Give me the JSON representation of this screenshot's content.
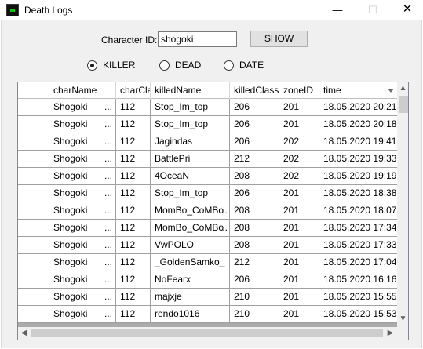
{
  "window": {
    "title": "Death Logs",
    "minimize_glyph": "—",
    "maximize_glyph": "☐",
    "close_glyph": "✕"
  },
  "form": {
    "character_label": "Character ID:",
    "character_value": "shogoki",
    "show_label": "SHOW",
    "radios": [
      {
        "label": "KILLER",
        "checked": true
      },
      {
        "label": "DEAD",
        "checked": false
      },
      {
        "label": "DATE",
        "checked": false
      }
    ]
  },
  "grid": {
    "columns": [
      "charName",
      "charCla",
      "killedName",
      "killedClass",
      "zoneID",
      "time"
    ],
    "rows": [
      [
        "Shogoki",
        "112",
        "Stop_Im_top",
        "206",
        "201",
        "18.05.2020 20:21"
      ],
      [
        "Shogoki",
        "112",
        "Stop_Im_top",
        "206",
        "201",
        "18.05.2020 20:18"
      ],
      [
        "Shogoki",
        "112",
        "Jagindas",
        "206",
        "202",
        "18.05.2020 19:41"
      ],
      [
        "Shogoki",
        "112",
        "BattlePri",
        "212",
        "202",
        "18.05.2020 19:33"
      ],
      [
        "Shogoki",
        "112",
        "4OceaN",
        "208",
        "202",
        "18.05.2020 19:19"
      ],
      [
        "Shogoki",
        "112",
        "Stop_Im_top",
        "206",
        "201",
        "18.05.2020 18:38"
      ],
      [
        "Shogoki",
        "112",
        "MomBo_CoMBo",
        "208",
        "201",
        "18.05.2020 18:07"
      ],
      [
        "Shogoki",
        "112",
        "MomBo_CoMBo",
        "208",
        "201",
        "18.05.2020 17:34"
      ],
      [
        "Shogoki",
        "112",
        "VwPOLO",
        "208",
        "201",
        "18.05.2020 17:33"
      ],
      [
        "Shogoki",
        "112",
        "_GoldenSamko_",
        "212",
        "201",
        "18.05.2020 17:04"
      ],
      [
        "Shogoki",
        "112",
        "NoFearx",
        "206",
        "201",
        "18.05.2020 16:16"
      ],
      [
        "Shogoki",
        "112",
        "majxje",
        "210",
        "201",
        "18.05.2020 15:55"
      ],
      [
        "Shogoki",
        "112",
        "rendo1016",
        "210",
        "201",
        "18.05.2020 15:53"
      ]
    ],
    "truncation_mark": "...",
    "killed_truncated_rows": [
      6,
      7
    ]
  }
}
